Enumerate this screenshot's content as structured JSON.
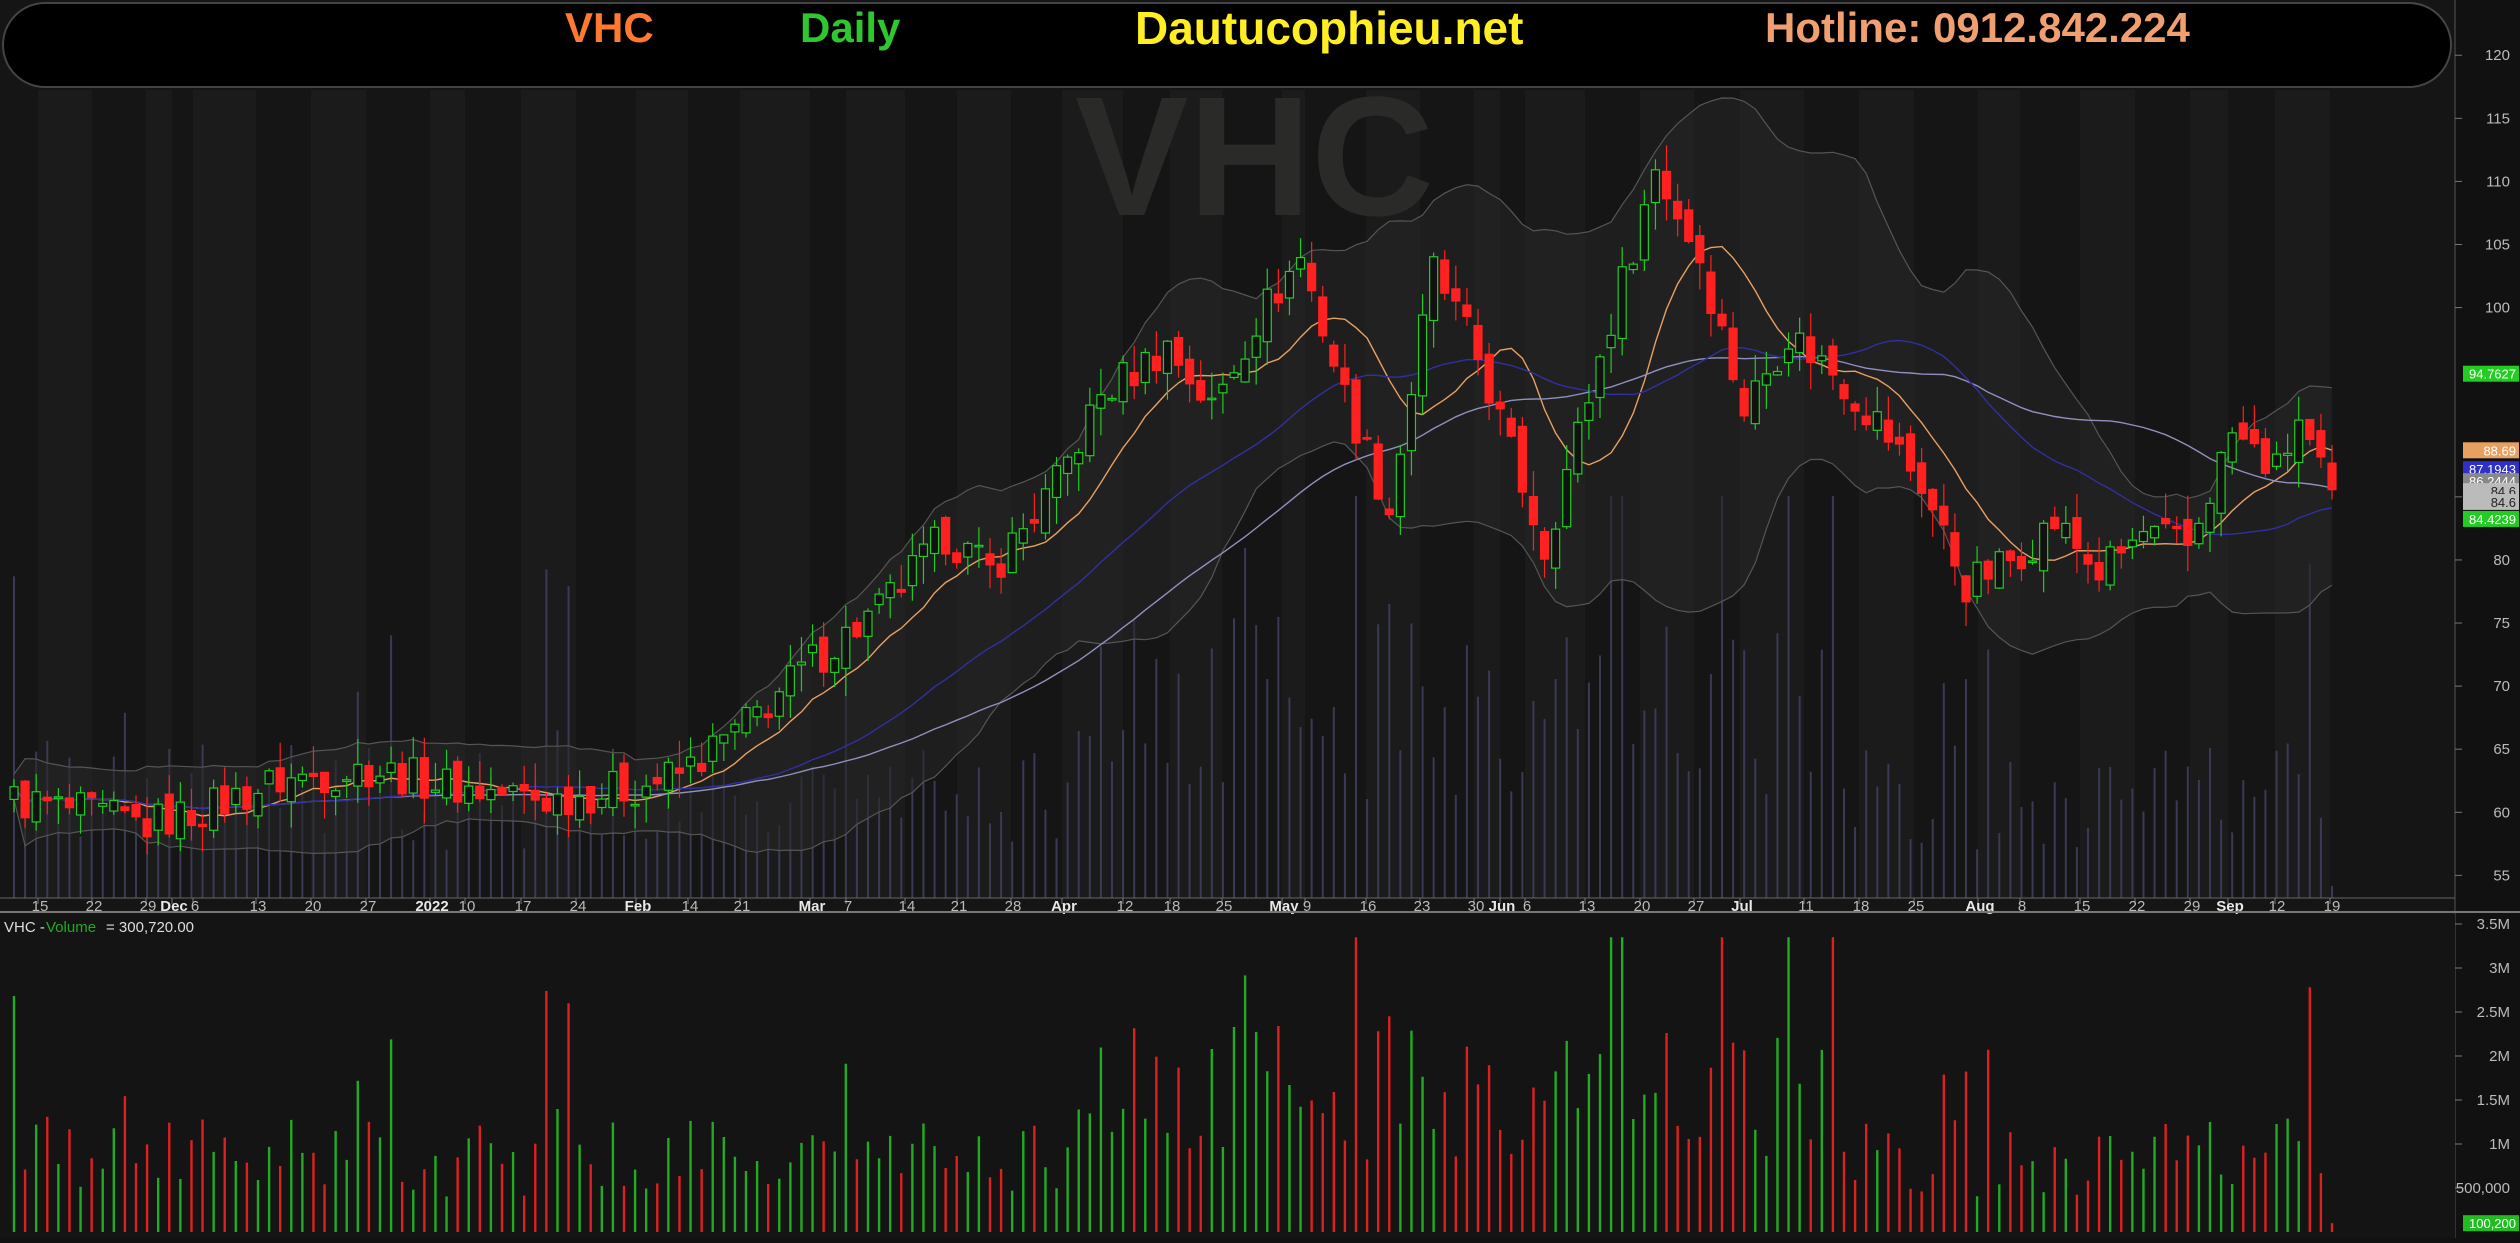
{
  "banner": {
    "ticker": "VHC",
    "timeframe": "Daily",
    "site": "Dautucophieu.net",
    "hotline": "Hotline: 0912.842.224",
    "colors": {
      "ticker": "#ff7a30",
      "timeframe": "#2ec82e",
      "site": "#ffee22",
      "hotline": "#f0a070"
    }
  },
  "watermark": "VHC",
  "chart_data": [
    {
      "type": "candlestick",
      "title": "",
      "ylim": [
        54,
        122
      ],
      "y_ticks": [
        "120",
        "115",
        "110",
        "105",
        "100",
        "85",
        "80",
        "75",
        "70",
        "65",
        "60",
        "55"
      ],
      "x_ticks": [
        "15",
        "22",
        "29",
        "Dec",
        "6",
        "13",
        "20",
        "27",
        "2022",
        "10",
        "17",
        "24",
        "Feb",
        "14",
        "21",
        "Mar",
        "7",
        "14",
        "21",
        "28",
        "Apr",
        "12",
        "18",
        "25",
        "May",
        "9",
        "16",
        "23",
        "30",
        "Jun",
        "6",
        "13",
        "20",
        "27",
        "Jul",
        "11",
        "18",
        "25",
        "Aug",
        "8",
        "15",
        "22",
        "29",
        "Sep",
        "12",
        "19"
      ],
      "price_labels": [
        {
          "text": "94.7627",
          "color": "#22cc22",
          "value": 94.76
        },
        {
          "text": "88.69",
          "color": "#e8a060",
          "value": 88.69
        },
        {
          "text": "87.1943",
          "color": "#3030c8",
          "value": 87.19
        },
        {
          "text": "86.2444",
          "color": "#888888",
          "value": 86.24
        },
        {
          "text": "84.6",
          "color": "#bbbbbb",
          "value": 85.45
        },
        {
          "text": "84.6",
          "color": "#bbbbbb",
          "value": 84.6
        },
        {
          "text": "84.4239",
          "color": "#22cc22",
          "value": 83.25
        }
      ],
      "series": [
        {
          "name": "MA fast",
          "color": "#e8a060"
        },
        {
          "name": "MA slow",
          "color": "#9090c0"
        },
        {
          "name": "MA mid",
          "color": "#3030a0"
        }
      ],
      "ohlc_sample_last": {
        "open": 86.2,
        "high": 87.0,
        "low": 84.2,
        "close": 84.6
      }
    },
    {
      "type": "bar",
      "legend_prefix": "VHC - ",
      "legend_label": "Volume",
      "legend_value": "= 300,720.00",
      "ylim": [
        0,
        3500000
      ],
      "y_ticks": [
        "3.5M",
        "3M",
        "2.5M",
        "2M",
        "1.5M",
        "1M",
        "500,000"
      ],
      "last_value_label": "100,200",
      "last_value": 100200
    }
  ]
}
